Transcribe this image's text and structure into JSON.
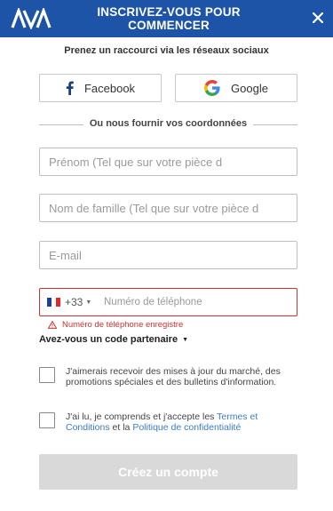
{
  "header": {
    "brand": "AVA",
    "title": "INSCRIVEZ-VOUS POUR COMMENCER"
  },
  "social": {
    "heading": "Prenez un raccourci via les réseaux sociaux",
    "facebook_label": "Facebook",
    "google_label": "Google"
  },
  "divider_text": "Ou nous fournir vos coordonnées",
  "form": {
    "first_name_placeholder": "Prénom (Tel que sur votre pièce d",
    "last_name_placeholder": "Nom de famille (Tel que sur votre pièce d",
    "email_placeholder": "E-mail",
    "phone": {
      "country_code": "+33",
      "placeholder": "Numéro de téléphone",
      "error": "Numéro de téléphone enregistre"
    },
    "partner_code_label": "Avez-vous un code partenaire",
    "newsletter_text": "J'aimerais recevoir des mises à jour du marché, des promotions spéciales et des bulletins d'information.",
    "terms_prefix": "J'ai lu, je comprends et j'accepte les ",
    "terms_link": "Termes et Conditions",
    "terms_middle": " et la ",
    "privacy_link": "Politique de confidentialité",
    "submit_label": "Créez un compte"
  },
  "colors": {
    "header_bg": "#1d54a8",
    "error": "#d32f2f",
    "link": "#3b7cc9",
    "submit_disabled": "#d9d9d9"
  },
  "icons": [
    "ava-logo",
    "close-icon",
    "facebook-icon",
    "google-icon",
    "france-flag-icon",
    "warning-icon",
    "chevron-down-icon"
  ]
}
